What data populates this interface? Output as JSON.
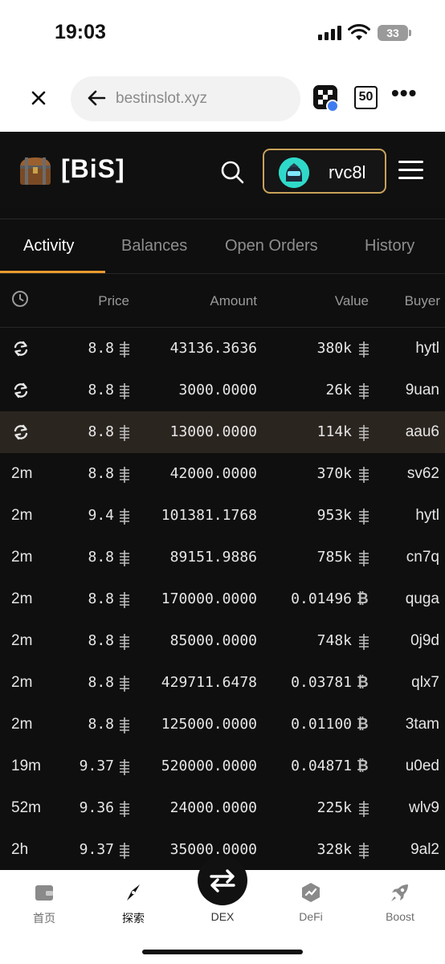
{
  "status_bar": {
    "time": "19:03",
    "battery": "33"
  },
  "browser": {
    "url": "bestinslot.xyz",
    "tab_count": "50"
  },
  "site": {
    "logo_text": "[BiS]",
    "username": "rvc8l"
  },
  "tabs": [
    {
      "label": "Activity",
      "active": true
    },
    {
      "label": "Balances",
      "active": false
    },
    {
      "label": "Open Orders",
      "active": false
    },
    {
      "label": "History",
      "active": false
    }
  ],
  "table": {
    "headers": {
      "price": "Price",
      "amount": "Amount",
      "value": "Value",
      "buyer": "Buyer"
    },
    "rows": [
      {
        "time": "",
        "time_icon": "refresh-icon",
        "price": "8.8",
        "amount": "43136.3636",
        "value": "380k",
        "value_unit": "fractal",
        "buyer": "hytl",
        "highlight": false
      },
      {
        "time": "",
        "time_icon": "refresh-icon",
        "price": "8.8",
        "amount": "3000.0000",
        "value": "26k",
        "value_unit": "fractal",
        "buyer": "9uan",
        "highlight": false
      },
      {
        "time": "",
        "time_icon": "refresh-icon",
        "price": "8.8",
        "amount": "13000.0000",
        "value": "114k",
        "value_unit": "fractal",
        "buyer": "aau6",
        "highlight": true
      },
      {
        "time": "2m",
        "price": "8.8",
        "amount": "42000.0000",
        "value": "370k",
        "value_unit": "fractal",
        "buyer": "sv62",
        "highlight": false
      },
      {
        "time": "2m",
        "price": "9.4",
        "amount": "101381.1768",
        "value": "953k",
        "value_unit": "fractal",
        "buyer": "hytl",
        "highlight": false
      },
      {
        "time": "2m",
        "price": "8.8",
        "amount": "89151.9886",
        "value": "785k",
        "value_unit": "fractal",
        "buyer": "cn7q",
        "highlight": false
      },
      {
        "time": "2m",
        "price": "8.8",
        "amount": "170000.0000",
        "value": "0.01496",
        "value_unit": "btc",
        "buyer": "quga",
        "highlight": false
      },
      {
        "time": "2m",
        "price": "8.8",
        "amount": "85000.0000",
        "value": "748k",
        "value_unit": "fractal",
        "buyer": "0j9d",
        "highlight": false
      },
      {
        "time": "2m",
        "price": "8.8",
        "amount": "429711.6478",
        "value": "0.03781",
        "value_unit": "btc",
        "buyer": "qlx7",
        "highlight": false
      },
      {
        "time": "2m",
        "price": "8.8",
        "amount": "125000.0000",
        "value": "0.01100",
        "value_unit": "btc",
        "buyer": "3tam",
        "highlight": false
      },
      {
        "time": "19m",
        "price": "9.37",
        "amount": "520000.0000",
        "value": "0.04871",
        "value_unit": "btc",
        "buyer": "u0ed",
        "highlight": false
      },
      {
        "time": "52m",
        "price": "9.36",
        "amount": "24000.0000",
        "value": "225k",
        "value_unit": "fractal",
        "buyer": "wlv9",
        "highlight": false
      },
      {
        "time": "2h",
        "price": "9.37",
        "amount": "35000.0000",
        "value": "328k",
        "value_unit": "fractal",
        "buyer": "9al2",
        "highlight": false
      }
    ]
  },
  "bottom_nav": {
    "items": [
      {
        "label": "首页",
        "icon": "wallet-icon"
      },
      {
        "label": "探索",
        "icon": "compass-icon",
        "active": true
      },
      {
        "label": "DEX",
        "icon": "swap-icon"
      },
      {
        "label": "DeFi",
        "icon": "defi-icon"
      },
      {
        "label": "Boost",
        "icon": "rocket-icon"
      }
    ]
  },
  "colors": {
    "accent": "#e99a2c",
    "user_border": "#c8a25a",
    "highlight_row": "#2b2520"
  }
}
